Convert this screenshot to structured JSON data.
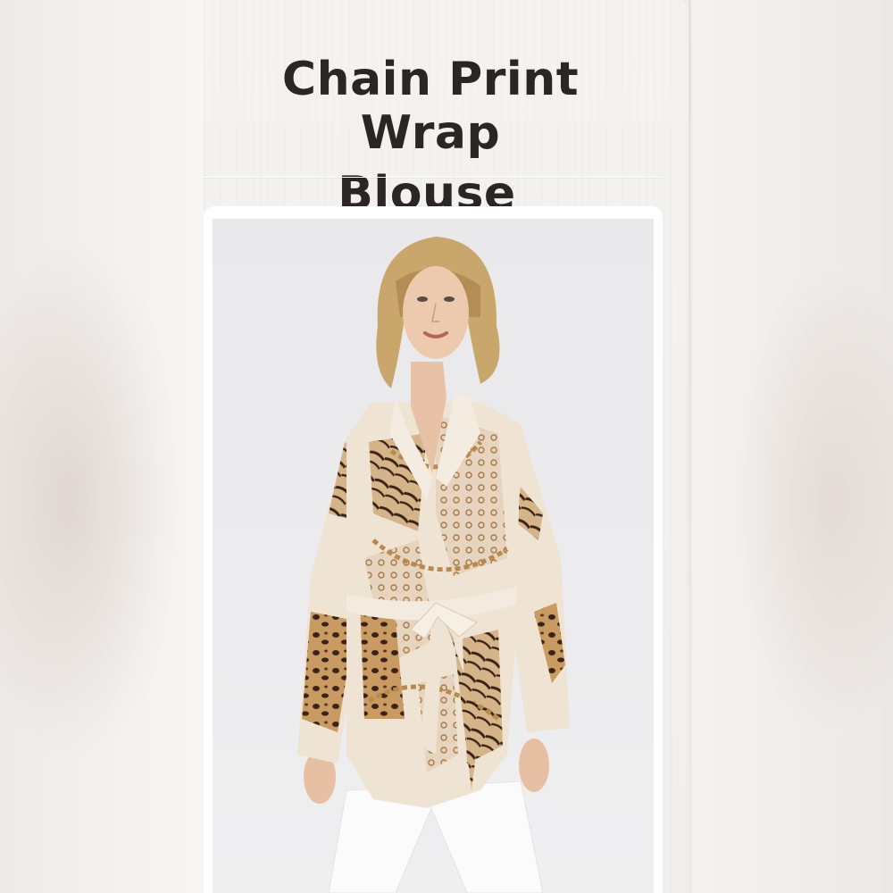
{
  "product": {
    "title_line1": "Chain Print Wrap",
    "title_line2": "Blouse"
  },
  "photo": {
    "subject": "product-photo-model-in-chain-print-wrap-blouse"
  },
  "colors": {
    "background": "#f3f1ef",
    "title_text": "#2b2523",
    "blouse_base": "#efe4d4",
    "print_brown": "#6b4428",
    "print_gold": "#b98a4e",
    "pants": "#ffffff"
  }
}
